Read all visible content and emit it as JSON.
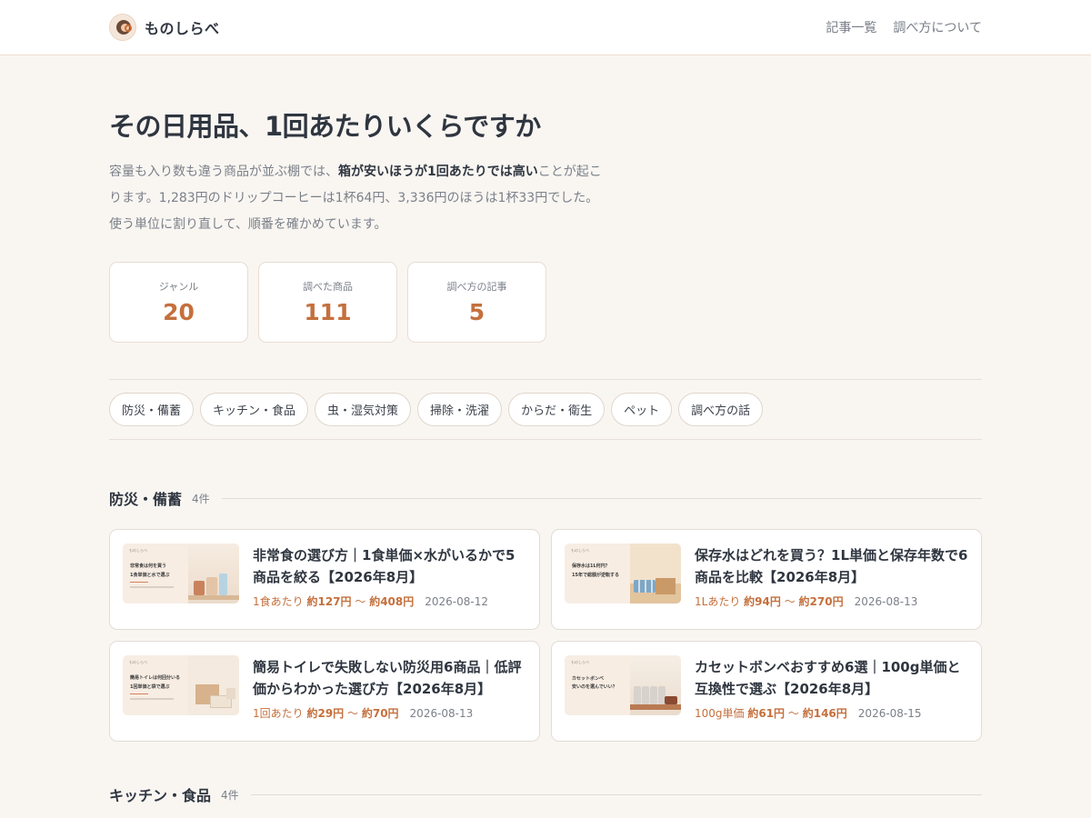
{
  "header": {
    "brand": "ものしらべ",
    "nav": [
      "記事一覧",
      "調べ方について"
    ]
  },
  "hero": {
    "title": "その日用品、1回あたりいくらですか",
    "lead_1": "容量も入り数も違う商品が並ぶ棚では、",
    "lead_bold": "箱が安いほうが1回あたりでは高い",
    "lead_2": "ことが起こります。1,283円のドリップコーヒーは1杯64円、3,336円のほうは1杯33円でした。使う単位に割り直して、順番を確かめています。"
  },
  "stats": [
    {
      "label": "ジャンル",
      "value": "20"
    },
    {
      "label": "調べた商品",
      "value": "111"
    },
    {
      "label": "調べ方の記事",
      "value": "5"
    }
  ],
  "chips": [
    "防災・備蓄",
    "キッチン・食品",
    "虫・湿気対策",
    "掃除・洗濯",
    "からだ・衛生",
    "ペット",
    "調べ方の話"
  ],
  "sections": [
    {
      "title": "防災・備蓄",
      "count": "4件",
      "articles": [
        {
          "title": "非常食の選び方｜1食単価×水がいるかで5商品を絞る【2026年8月】",
          "unit": "1食あたり",
          "low": "約127円",
          "sep": "〜",
          "high": "約408円",
          "date": "2026-08-12",
          "thumb": {
            "brand": "ものしらべ",
            "line1": "非常食は何を買う",
            "line2": "1食単価と水で選ぶ"
          }
        },
        {
          "title": "保存水はどれを買う？1L単価と保存年数で6商品を比較【2026年8月】",
          "unit": "1Lあたり",
          "low": "約94円",
          "sep": "〜",
          "high": "約270円",
          "date": "2026-08-13",
          "thumb": {
            "brand": "ものしらべ",
            "line1": "保存水は1L何円？",
            "line2": "15年で総額が逆転する"
          }
        },
        {
          "title": "簡易トイレで失敗しない防災用6商品｜低評価からわかった選び方【2026年8月】",
          "unit": "1回あたり",
          "low": "約29円",
          "sep": "〜",
          "high": "約70円",
          "date": "2026-08-13",
          "thumb": {
            "brand": "ものしらべ",
            "line1": "簡易トイレは何回分いる",
            "line2": "1回単価と袋で選ぶ"
          }
        },
        {
          "title": "カセットボンベおすすめ6選｜100g単価と互換性で選ぶ【2026年8月】",
          "unit": "100g単価",
          "low": "約61円",
          "sep": "〜",
          "high": "約146円",
          "date": "2026-08-15",
          "thumb": {
            "brand": "ものしらべ",
            "line1": "カセットボンベ",
            "line2": "安いのを選んでいい？"
          }
        }
      ]
    },
    {
      "title": "キッチン・食品",
      "count": "4件"
    }
  ]
}
